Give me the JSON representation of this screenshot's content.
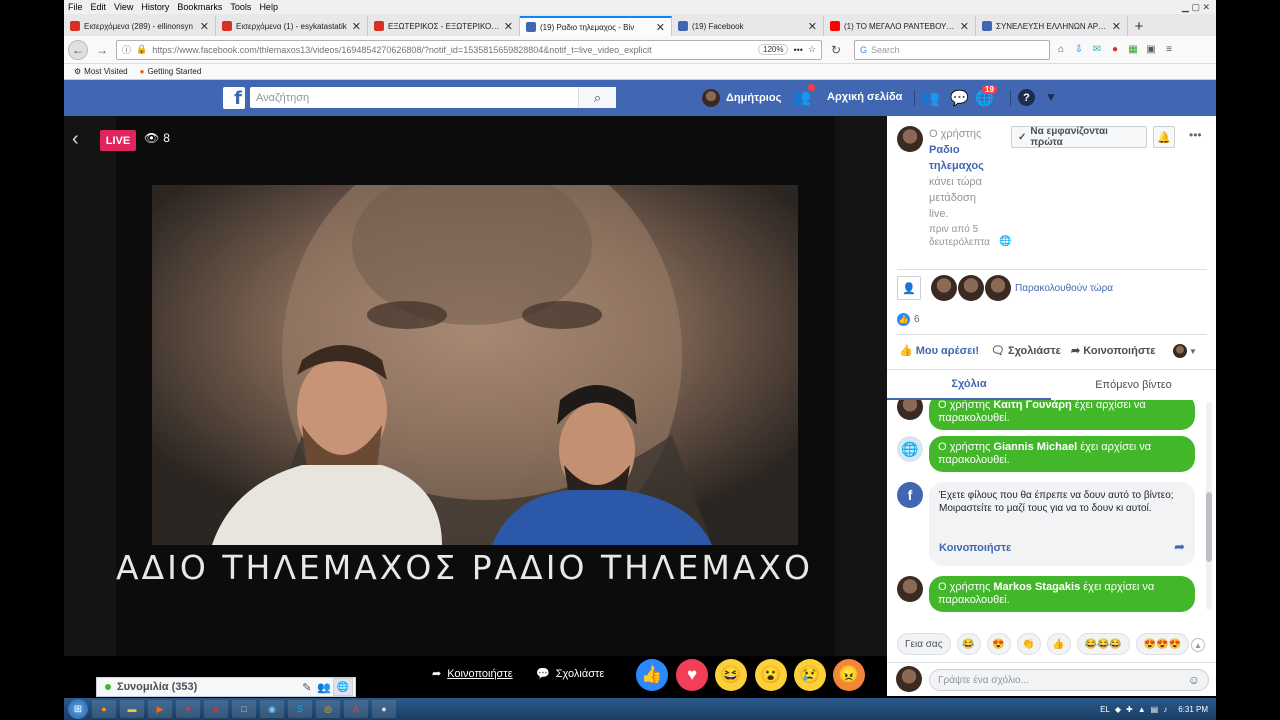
{
  "browser": {
    "menu": [
      "File",
      "Edit",
      "View",
      "History",
      "Bookmarks",
      "Tools",
      "Help"
    ],
    "tabs": [
      {
        "title": "Εισερχόμενα (289) - ellinonsyn",
        "favicon_color": "#d93025",
        "active": false
      },
      {
        "title": "Εισερχόμενα (1) - esykatastatik",
        "favicon_color": "#d93025",
        "active": false
      },
      {
        "title": "ΕΞΩΤΕΡΙΚΟΣ - ΕΞΩΤΕΡΙΚΟΣ ΚΑ",
        "favicon_color": "#d93025",
        "active": false
      },
      {
        "title": "(19) Ραδιο τηλεμαχος - Βίν",
        "favicon_color": "#4267b2",
        "active": true
      },
      {
        "title": "(19) Facebook",
        "favicon_color": "#4267b2",
        "active": false
      },
      {
        "title": "(1) ΤΟ ΜΕΓΑΛΟ ΡΑΝΤΕΒΟΥ ΣΤ",
        "favicon_color": "#ff0000",
        "active": false
      },
      {
        "title": "ΣΥΝΕΛΕΥΣΗ ΕΛΛΗΝΩΝ ΑΡΤΕΜ",
        "favicon_color": "#4267b2",
        "active": false
      }
    ],
    "url": "https://www.facebook.com/thlemaxos13/videos/1694854270626808/?notif_id=1535815659828804&notif_t=live_video_explicit",
    "zoom": "120%",
    "more": "•••",
    "search_placeholder": "Search",
    "bookmarks": [
      "Most Visited",
      "Getting Started"
    ]
  },
  "facebook": {
    "search_placeholder": "Αναζήτηση",
    "user_name": "Δημήτριος",
    "home_label": "Αρχική σελίδα",
    "notif_count": "19"
  },
  "video": {
    "live_label": "LIVE",
    "viewer_count": "8",
    "banner_text": "ΑΔΙΟ ΤΗΛΕΜΑΧΟΣ ΡΑΔΙΟ ΤΗΛΕΜΑΧΟ",
    "share_label": "Κοινοποιήστε",
    "comment_label": "Σχολιάστε",
    "reactions": [
      "like-icon",
      "love-icon",
      "haha-icon",
      "wow-icon",
      "sad-icon",
      "angry-icon"
    ]
  },
  "chat": {
    "label": "Συνομιλία (353)"
  },
  "panel": {
    "header_prefix": "Ο χρήστης",
    "page_name_line1": "Ραδιο",
    "page_name_line2": "τηλεμαχος",
    "action_lines": [
      "κάνει τώρα",
      "μετάδοση",
      "live."
    ],
    "time_lines": [
      "πριν από 5",
      "δευτερόλεπτα"
    ],
    "see_first_label": "Να εμφανίζονται πρώτα",
    "watching_label": "Παρακολουθούν τώρα",
    "like_count": "6",
    "like_label": "Μου αρέσει!",
    "comment_label": "Σχολιάστε",
    "share_label": "Κοινοποιήστε",
    "tab_comments": "Σχόλια",
    "tab_next": "Επόμενο βίντεο",
    "feed": [
      {
        "prefix": "Ο χρήστης",
        "name": "Καιτη Γουνάρη",
        "suffix": "έχει αρχίσει να",
        "line2": "παρακολουθεί."
      },
      {
        "prefix": "Ο χρήστης",
        "name": "Giannis Michael",
        "suffix": "έχει αρχίσει να",
        "line2": "παρακολουθεί."
      },
      {
        "prefix": "Ο χρήστης",
        "name": "Markos Stagakis",
        "suffix": "έχει αρχίσει να",
        "line2": "παρακολουθεί."
      }
    ],
    "share_prompt": "Έχετε φίλους που θα έπρεπε να δουν αυτό το βίντεο; Μοιραστείτε το μαζί τους για να το δουν κι αυτοί.",
    "share_link": "Κοινοποιήστε",
    "quick_replies": [
      "Γεια σας",
      "😂",
      "😍",
      "👏",
      "👍",
      "😂😂😂",
      "😍😍😍"
    ],
    "comment_placeholder": "Γράψτε ένα σχόλιο..."
  },
  "taskbar": {
    "lang": "EL",
    "time": "6:31 PM"
  }
}
